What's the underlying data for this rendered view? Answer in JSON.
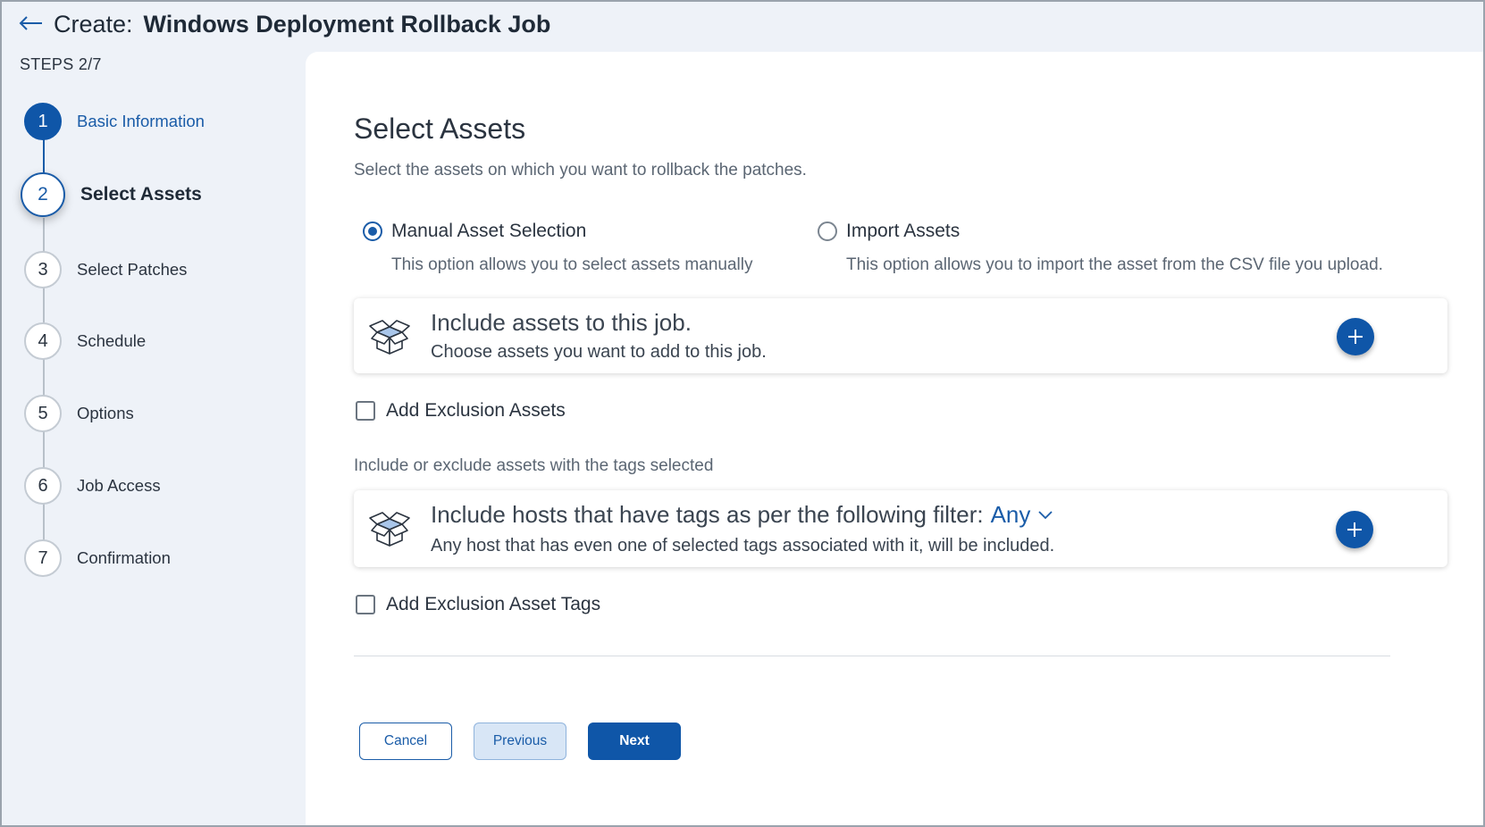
{
  "header": {
    "title_prefix": "Create:",
    "title_name": "Windows Deployment Rollback Job"
  },
  "steps_count": "STEPS 2/7",
  "steps": [
    {
      "number": "1",
      "label": "Basic Information",
      "state": "done"
    },
    {
      "number": "2",
      "label": "Select Assets",
      "state": "current"
    },
    {
      "number": "3",
      "label": "Select Patches",
      "state": "pending"
    },
    {
      "number": "4",
      "label": "Schedule",
      "state": "pending"
    },
    {
      "number": "5",
      "label": "Options",
      "state": "pending"
    },
    {
      "number": "6",
      "label": "Job Access",
      "state": "pending"
    },
    {
      "number": "7",
      "label": "Confirmation",
      "state": "pending"
    }
  ],
  "main": {
    "title": "Select Assets",
    "subtitle": "Select the assets on which you want to rollback the patches.",
    "options": [
      {
        "label": "Manual Asset Selection",
        "description": "This option allows you to select assets manually",
        "selected": true
      },
      {
        "label": "Import Assets",
        "description": "This option allows you to import the asset from the CSV file you upload.",
        "selected": false
      }
    ],
    "include_card": {
      "title": "Include assets to this job.",
      "subtitle": "Choose assets you want to add to this job."
    },
    "exclusion_assets_label": "Add Exclusion Assets",
    "tags_hint": "Include or exclude assets with the tags selected",
    "tags_card": {
      "title": "Include hosts that have tags as per the following filter:",
      "filter_value": "Any",
      "subtitle": "Any host that has even one of selected tags associated with it, will be included."
    },
    "exclusion_tags_label": "Add Exclusion Asset Tags"
  },
  "footer": {
    "cancel_label": "Cancel",
    "previous_label": "Previous",
    "next_label": "Next"
  },
  "colors": {
    "accent": "#0f56a8",
    "sidebar_bg": "#eef2f8",
    "text": "#2b3440"
  },
  "icons": {
    "back": "arrow-left-icon",
    "box": "open-box-icon",
    "add": "plus-icon",
    "dropdown": "chevron-down-icon"
  }
}
